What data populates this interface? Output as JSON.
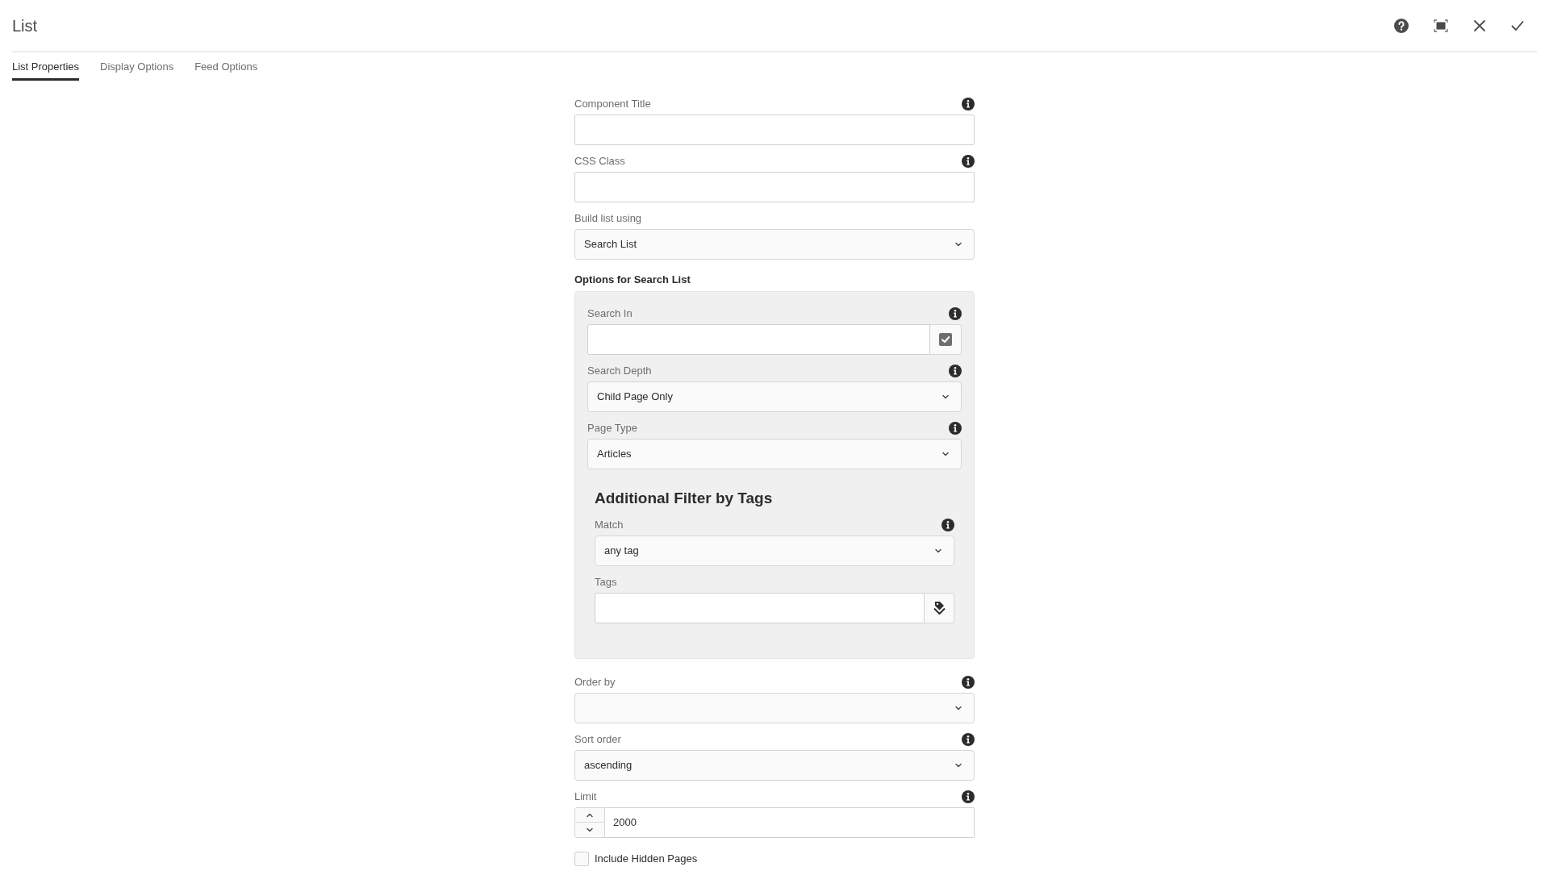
{
  "dialog": {
    "title": "List"
  },
  "tabs": [
    {
      "label": "List Properties",
      "selected": true
    },
    {
      "label": "Display Options",
      "selected": false
    },
    {
      "label": "Feed Options",
      "selected": false
    }
  ],
  "fields": [
    {
      "kind": "text",
      "label": "Component Title",
      "info": true
    },
    {
      "kind": "text",
      "label": "CSS Class",
      "info": true
    },
    {
      "kind": "select",
      "label": "Build list using",
      "info": false,
      "value": "Search List"
    },
    {
      "kind": "group",
      "heading": "Options for Search List",
      "fields": [
        {
          "kind": "path",
          "label": "Search In",
          "info": true
        },
        {
          "kind": "select",
          "label": "Search Depth",
          "info": true,
          "value": "Child Page Only"
        },
        {
          "kind": "select",
          "label": "Page Type",
          "info": true,
          "value": "Articles"
        },
        {
          "kind": "fieldset",
          "heading": "Additional Filter by Tags",
          "fields": [
            {
              "kind": "select",
              "label": "Match",
              "info": true,
              "value": "any tag"
            },
            {
              "kind": "tags",
              "label": "Tags",
              "info": false
            }
          ]
        }
      ]
    },
    {
      "kind": "select",
      "label": "Order by",
      "info": true
    },
    {
      "kind": "select",
      "label": "Sort order",
      "info": true,
      "value": "ascending"
    },
    {
      "kind": "number",
      "label": "Limit",
      "info": true,
      "value": "2000"
    },
    {
      "kind": "checkbox",
      "label": "Include Hidden Pages",
      "checked": false
    }
  ]
}
